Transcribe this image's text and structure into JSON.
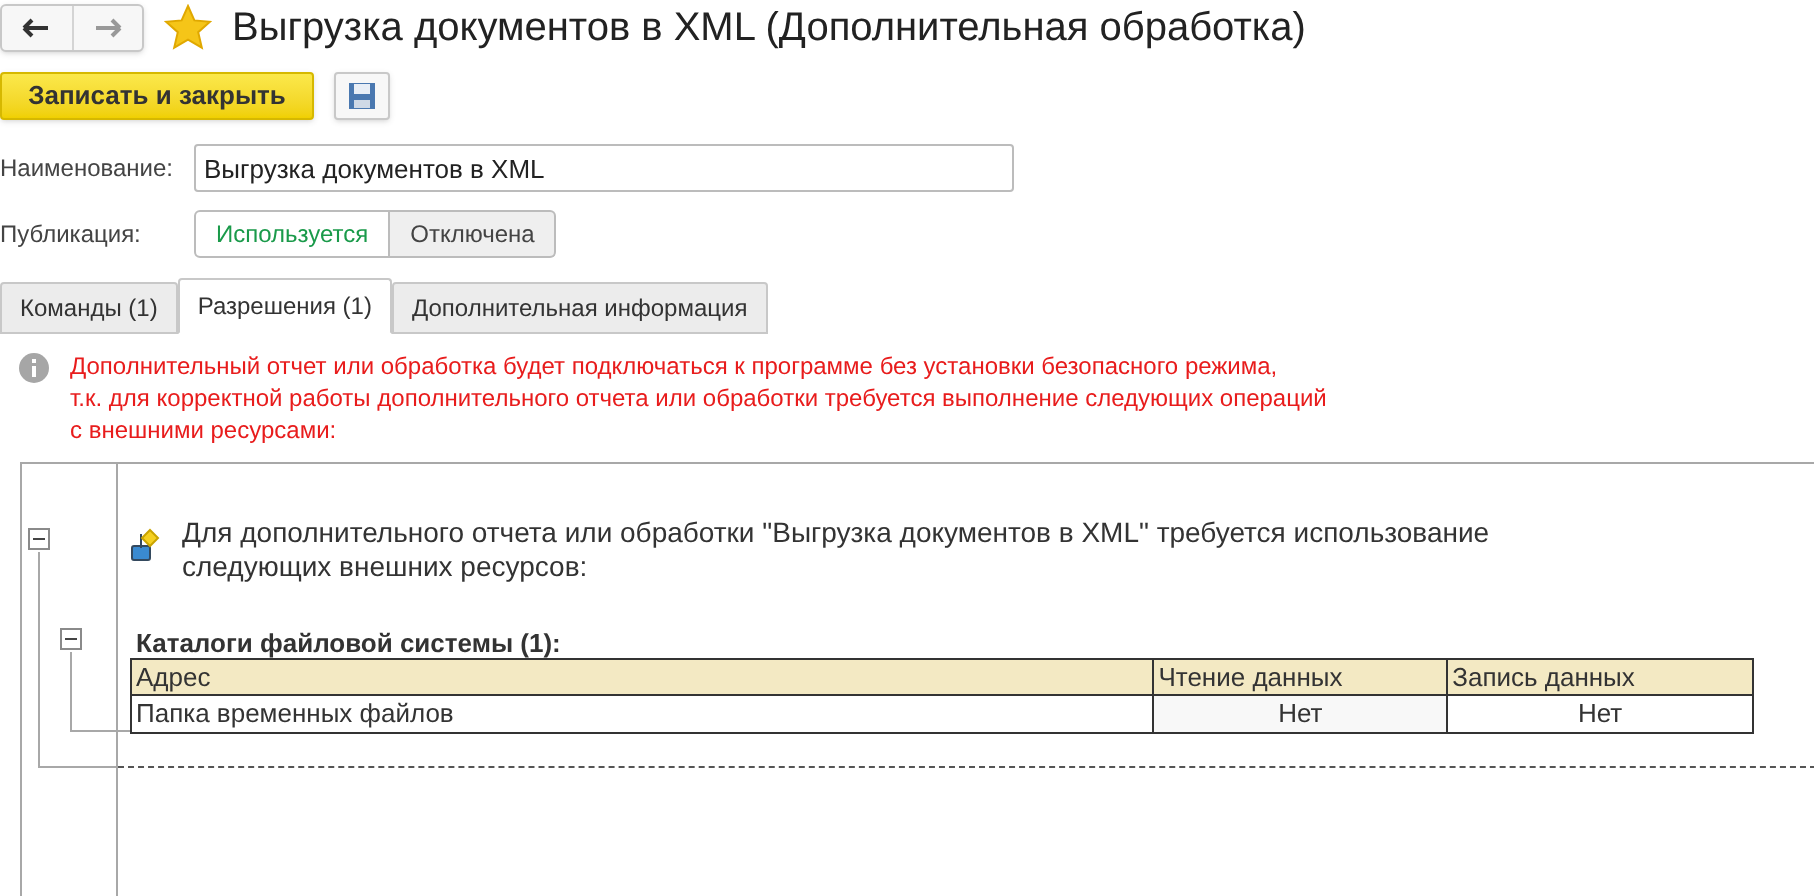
{
  "window": {
    "title": "Выгрузка документов в XML (Дополнительная обработка)",
    "favorite": true
  },
  "toolbar": {
    "primary_button": "Записать и закрыть"
  },
  "fields": [
    {
      "label": "Наименование:",
      "value": "Выгрузка документов в XML"
    }
  ],
  "publication": {
    "label": "Публикация:",
    "options": [
      {
        "label": "Используется",
        "selected": true
      },
      {
        "label": "Отключена",
        "selected": false
      }
    ]
  },
  "tabs": [
    {
      "label": "Команды (1)",
      "selected": false
    },
    {
      "label": "Разрешения (1)",
      "selected": true
    },
    {
      "label": "Дополнительная информация",
      "selected": false
    }
  ],
  "warning": {
    "lines": [
      "Дополнительный отчет или обработка будет подключаться к программе без установки безопасного режима,",
      "т.к. для корректной работы дополнительного отчета или обработки требуется выполнение следующих операций",
      "с внешними ресурсами:"
    ]
  },
  "permissions": {
    "expanded": true,
    "intro_lines": [
      "Для дополнительного отчета или обработки \"Выгрузка документов в XML\" требуется использование",
      "следующих внешних ресурсов:"
    ],
    "groups": [
      {
        "title": "Каталоги файловой системы (1):",
        "expanded": true,
        "columns": [
          "Адрес",
          "Чтение данных",
          "Запись данных"
        ],
        "rows": [
          [
            "Папка временных файлов",
            "Нет",
            "Нет"
          ]
        ]
      }
    ]
  }
}
